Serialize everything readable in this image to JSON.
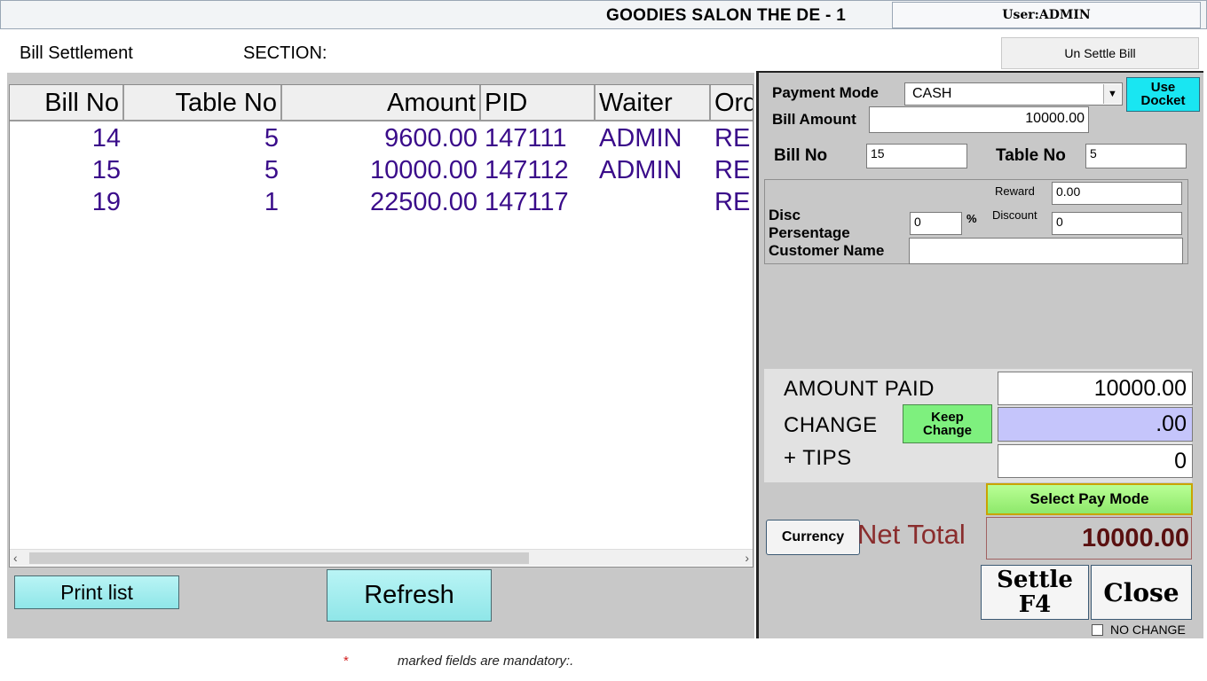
{
  "window": {
    "title": "GOODIES SALON THE DE - 1",
    "user": "User:ADMIN"
  },
  "header": {
    "screen_title": "Bill Settlement",
    "section_label": "SECTION:",
    "unsettle_button": "Un Settle Bill"
  },
  "grid": {
    "columns": [
      "Bill No",
      "Table No",
      "Amount",
      "PID",
      "Waiter",
      "Ord"
    ],
    "rows": [
      {
        "bill_no": "14",
        "table_no": "5",
        "amount": "9600.00",
        "pid": "147111",
        "waiter": "ADMIN",
        "ord": "RE"
      },
      {
        "bill_no": "15",
        "table_no": "5",
        "amount": "10000.00",
        "pid": "147112",
        "waiter": "ADMIN",
        "ord": "RE"
      },
      {
        "bill_no": "19",
        "table_no": "1",
        "amount": "22500.00",
        "pid": "147117",
        "waiter": "",
        "ord": "RE"
      }
    ]
  },
  "left_buttons": {
    "print_list": "Print list",
    "refresh": "Refresh"
  },
  "footer": {
    "mandatory_star": "*",
    "mandatory_text": "marked fields are mandatory:."
  },
  "payment": {
    "payment_mode_label": "Payment Mode",
    "payment_mode_value": "CASH",
    "use_docket_line1": "Use",
    "use_docket_line2": "Docket",
    "bill_amount_label": "Bill Amount",
    "bill_amount_value": "10000.00",
    "bill_no_label": "Bill No",
    "bill_no_value": "15",
    "table_no_label": "Table No",
    "table_no_value": "5",
    "reward_label": "Reward",
    "reward_value": "0.00",
    "disc_label_line1": "Disc",
    "disc_label_line2": "Persentage",
    "disc_value": "0",
    "percent_sign": "%",
    "discount_label": "Discount",
    "discount_value": "0",
    "customer_name_label": "Customer Name",
    "customer_name_value": "",
    "amount_paid_label": "AMOUNT PAID",
    "amount_paid_value": "10000.00",
    "change_label": "CHANGE",
    "change_value": ".00",
    "keep_change_line1": "Keep",
    "keep_change_line2": "Change",
    "tips_label": "+ TIPS",
    "tips_value": "0",
    "select_pay_mode": "Select Pay Mode",
    "currency_button": "Currency",
    "net_total_label": "Net Total",
    "net_total_value": "10000.00",
    "settle_line1": "Settle",
    "settle_line2": "F4",
    "close_button": "Close",
    "no_change_label": "NO CHANGE"
  },
  "colors": {
    "grid_text": "#3a0c8a",
    "use_docket_bg": "#19e6f2",
    "keep_change_bg": "#7ef07e",
    "change_bg": "#c5c5fb",
    "net_total_label": "#8a2d2d"
  }
}
